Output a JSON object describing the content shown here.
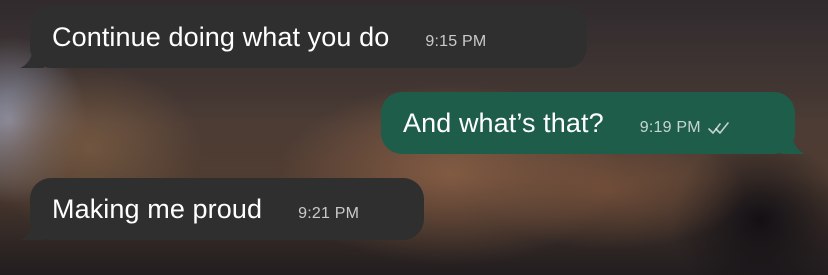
{
  "conversation": {
    "messages": [
      {
        "text": "Continue doing what you do",
        "time": "9:15 PM",
        "direction": "incoming"
      },
      {
        "text": "And what’s that?",
        "time": "9:19 PM",
        "direction": "outgoing",
        "status_icon": "double-check-icon"
      },
      {
        "text": "Making me proud",
        "time": "9:21 PM",
        "direction": "incoming"
      }
    ]
  },
  "colors": {
    "incoming_bubble": "#2f2f2f",
    "outgoing_bubble": "#1f5d4b",
    "message_text": "#ffffff",
    "timestamp_text": "#bcbcbc"
  }
}
